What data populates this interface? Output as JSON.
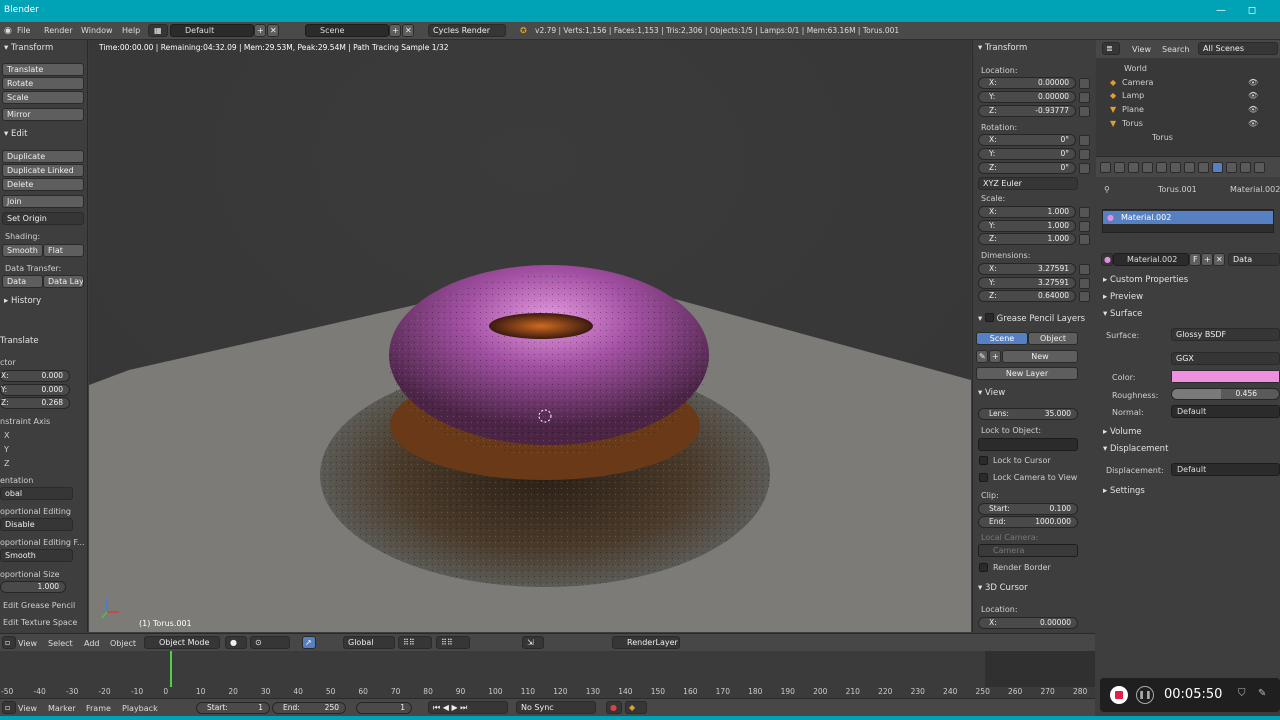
{
  "window": {
    "title": "Blender",
    "min": "—",
    "max": "◻",
    "close": "✕"
  },
  "menu": {
    "file": "File",
    "render": "Render",
    "window": "Window",
    "help": "Help",
    "layout": "Default",
    "scene": "Scene",
    "engine": "Cycles Render",
    "stats": "v2.79 | Verts:1,156 | Faces:1,153 | Tris:2,306 | Objects:1/5 | Lamps:0/1 | Mem:63.16M | Torus.001"
  },
  "toolshelf": {
    "transform_header": "Transform",
    "translate": "Translate",
    "rotate": "Rotate",
    "scale": "Scale",
    "mirror": "Mirror",
    "edit_header": "Edit",
    "duplicate": "Duplicate",
    "duplicate_linked": "Duplicate Linked",
    "delete": "Delete",
    "join": "Join",
    "set_origin": "Set Origin",
    "shading": "Shading:",
    "smooth": "Smooth",
    "flat": "Flat",
    "data_transfer": "Data Transfer:",
    "data": "Data",
    "data_layo": "Data Layo",
    "history": "History"
  },
  "operator": {
    "title": "Translate",
    "vector": "ctor",
    "x_label": "X:",
    "x": "0.000",
    "y_label": "Y:",
    "y": "0.000",
    "z_label": "Z:",
    "z": "0.268",
    "constraint": "nstraint Axis",
    "cx": "X",
    "cy": "Y",
    "cz": "Z",
    "orientation": "entation",
    "orientation_val": "obal",
    "prop_edit": "oportional Editing",
    "prop_edit_val": "Disable",
    "prop_falloff": "oportional Editing F...",
    "prop_falloff_val": "Smooth",
    "prop_size": "oportional Size",
    "prop_size_val": "1.000",
    "grease": "Edit Grease Pencil",
    "texspace": "Edit Texture Space"
  },
  "viewport": {
    "info": "Time:00:00.00 | Remaining:04:32.09 | Mem:29.53M, Peak:29.54M | Path Tracing Sample 1/32",
    "object_label": "(1) Torus.001"
  },
  "npanel": {
    "transform": "Transform",
    "location": "Location:",
    "loc_x": "0.00000",
    "loc_y": "0.00000",
    "loc_z": "-0.93777",
    "rotation": "Rotation:",
    "rot_x": "0°",
    "rot_y": "0°",
    "rot_z": "0°",
    "euler": "XYZ Euler",
    "scale": "Scale:",
    "sc_x": "1.000",
    "sc_y": "1.000",
    "sc_z": "1.000",
    "dimensions": "Dimensions:",
    "dim_x": "3.27591",
    "dim_y": "3.27591",
    "dim_z": "0.64000",
    "x": "X:",
    "y": "Y:",
    "z": "Z:",
    "gp_layers": "Grease Pencil Layers",
    "scene": "Scene",
    "object": "Object",
    "new": "New",
    "new_layer": "New Layer",
    "view": "View",
    "lens_label": "Lens:",
    "lens": "35.000",
    "lock_object": "Lock to Object:",
    "lock_cursor": "Lock to Cursor",
    "lock_camera": "Lock Camera to View",
    "clip": "Clip:",
    "start_label": "Start:",
    "clip_start": "0.100",
    "end_label": "End:",
    "clip_end": "1000.000",
    "local_camera": "Local Camera:",
    "camera": "Camera",
    "render_border": "Render Border",
    "cursor": "3D Cursor",
    "cur_loc": "Location:",
    "cur_x": "0.00000"
  },
  "outliner": {
    "view": "View",
    "search": "Search",
    "all_scenes": "All Scenes",
    "items": [
      "World",
      "Camera",
      "Lamp",
      "Plane",
      "Torus",
      "Torus"
    ]
  },
  "properties": {
    "torus": "Torus.001",
    "material": "Material.002",
    "slot": "Material.002",
    "mat_name": "Material.002",
    "f": "F",
    "data": "Data",
    "custom_props": "Custom Properties",
    "preview": "Preview",
    "surface": "Surface",
    "surface_label": "Surface:",
    "surface_val": "Glossy BSDF",
    "dist_val": "GGX",
    "color_label": "Color:",
    "color": "#ee90dd",
    "rough_label": "Roughness:",
    "roughness": "0.456",
    "roughness_frac": 0.456,
    "normal_label": "Normal:",
    "normal_val": "Default",
    "volume": "Volume",
    "displacement": "Displacement",
    "disp_label": "Displacement:",
    "disp_val": "Default",
    "settings": "Settings"
  },
  "header3d": {
    "view": "View",
    "select": "Select",
    "add": "Add",
    "object": "Object",
    "mode": "Object Mode",
    "global": "Global",
    "render_layer": "RenderLayer"
  },
  "timeline": {
    "ticks": [
      "-50",
      "-40",
      "-30",
      "-20",
      "-10",
      "0",
      "10",
      "20",
      "30",
      "40",
      "50",
      "60",
      "70",
      "80",
      "90",
      "100",
      "110",
      "120",
      "130",
      "140",
      "150",
      "160",
      "170",
      "180",
      "190",
      "200",
      "210",
      "220",
      "230",
      "240",
      "250",
      "260",
      "270",
      "280"
    ],
    "current_frame": 0
  },
  "tlhdr": {
    "view": "View",
    "marker": "Marker",
    "frame": "Frame",
    "playback": "Playback",
    "start_label": "Start:",
    "start": "1",
    "end_label": "End:",
    "end": "250",
    "current": "1",
    "sync": "No Sync"
  },
  "recorder": {
    "time": "00:05:50"
  }
}
